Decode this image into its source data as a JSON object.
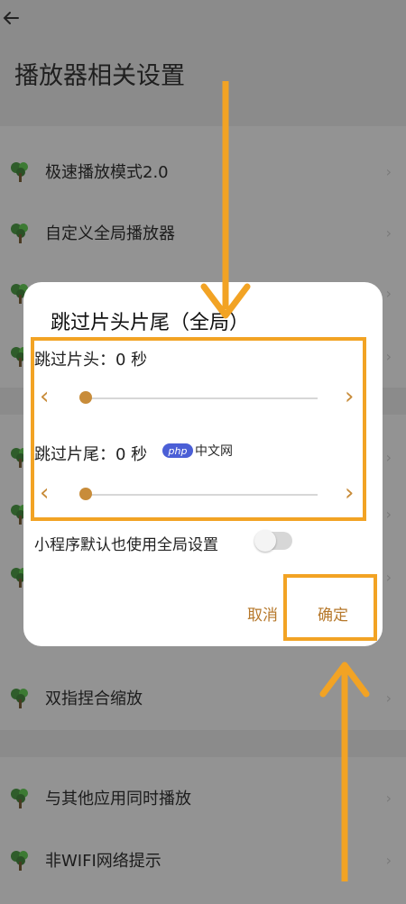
{
  "page": {
    "title": "播放器相关设置",
    "settings_rows": [
      {
        "label": "极速播放模式2.0"
      },
      {
        "label": "自定义全局播放器"
      },
      {
        "label": ""
      },
      {
        "label": ""
      },
      {
        "label": ""
      },
      {
        "label": ""
      },
      {
        "label": ""
      },
      {
        "label": "双指捏合缩放"
      },
      {
        "label": "与其他应用同时播放"
      },
      {
        "label": "非WIFI网络提示"
      }
    ],
    "icons": {
      "back": "back-arrow-icon",
      "row": "tree-icon",
      "row_arrow": "chevron-right-icon"
    }
  },
  "dialog": {
    "title": "跳过片头片尾（全局）",
    "skip_head": {
      "label": "跳过片头：0 秒",
      "value_seconds": 0,
      "position_fraction": 0
    },
    "skip_tail": {
      "label": "跳过片尾：0 秒",
      "value_seconds": 0,
      "position_fraction": 0
    },
    "decrease_glyph": "‹",
    "increase_glyph": "›",
    "mini_program_switch": {
      "label": "小程序默认也使用全局设置",
      "on": false
    },
    "cancel_label": "取消",
    "confirm_label": "确定"
  },
  "watermark": {
    "logo": "php",
    "text": "中文网"
  },
  "colors": {
    "accent": "#c88c3a",
    "annotation": "#f2a324",
    "dim_background": "#8b8b8b",
    "dialog_bg": "#ffffff"
  }
}
